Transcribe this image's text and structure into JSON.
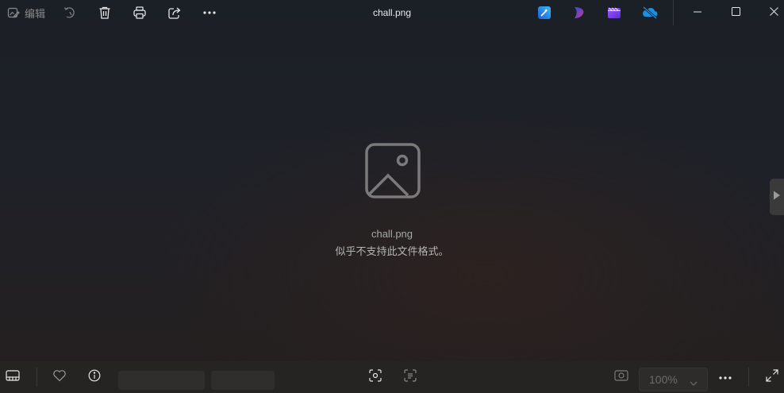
{
  "titlebar": {
    "edit_label": "编辑",
    "file_title": "chall.png",
    "icons": [
      "edit-icon",
      "rotate-icon",
      "delete-icon",
      "print-icon",
      "share-icon",
      "more-icon"
    ],
    "apps": [
      "designer-app-icon",
      "clipchamp-app-icon",
      "video-editor-app-icon",
      "onedrive-icon"
    ],
    "window_controls": [
      "minimize-icon",
      "maximize-icon",
      "close-icon"
    ]
  },
  "viewer": {
    "filename": "chall.png",
    "message": "似乎不支持此文件格式。"
  },
  "bottombar": {
    "zoom_value": "100%",
    "icons": [
      "filmstrip-icon",
      "heart-icon",
      "info-icon",
      "visual-search-icon",
      "text-scan-icon",
      "actual-size-icon",
      "more-icon",
      "fullscreen-icon"
    ]
  },
  "colors": {
    "background_top": "#1b1f26",
    "background_bottom": "#241f1e",
    "bottombar": "#262422",
    "accent_blue": "#1e8ee0"
  }
}
